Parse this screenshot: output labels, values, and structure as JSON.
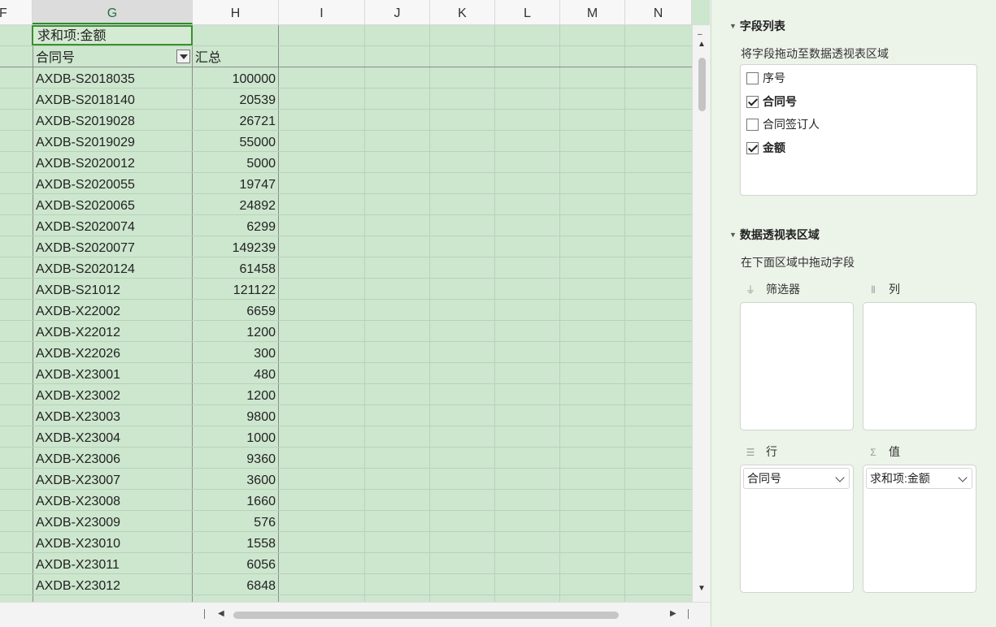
{
  "sheet": {
    "columns": [
      "F",
      "G",
      "H",
      "I",
      "J",
      "K",
      "L",
      "M",
      "N"
    ],
    "selected_column": "G",
    "pivot_title": "求和项:金额",
    "row_header_label": "合同号",
    "total_header_label": "汇总",
    "rows": [
      {
        "contract": "AXDB-S2018035",
        "amount": "100000"
      },
      {
        "contract": "AXDB-S2018140",
        "amount": "20539"
      },
      {
        "contract": "AXDB-S2019028",
        "amount": "26721"
      },
      {
        "contract": "AXDB-S2019029",
        "amount": "55000"
      },
      {
        "contract": "AXDB-S2020012",
        "amount": "5000"
      },
      {
        "contract": "AXDB-S2020055",
        "amount": "19747"
      },
      {
        "contract": "AXDB-S2020065",
        "amount": "24892"
      },
      {
        "contract": "AXDB-S2020074",
        "amount": "6299"
      },
      {
        "contract": "AXDB-S2020077",
        "amount": "149239"
      },
      {
        "contract": "AXDB-S2020124",
        "amount": "61458"
      },
      {
        "contract": "AXDB-S21012",
        "amount": "121122"
      },
      {
        "contract": "AXDB-X22002",
        "amount": "6659"
      },
      {
        "contract": "AXDB-X22012",
        "amount": "1200"
      },
      {
        "contract": "AXDB-X22026",
        "amount": "300"
      },
      {
        "contract": "AXDB-X23001",
        "amount": "480"
      },
      {
        "contract": "AXDB-X23002",
        "amount": "1200"
      },
      {
        "contract": "AXDB-X23003",
        "amount": "9800"
      },
      {
        "contract": "AXDB-X23004",
        "amount": "1000"
      },
      {
        "contract": "AXDB-X23006",
        "amount": "9360"
      },
      {
        "contract": "AXDB-X23007",
        "amount": "3600"
      },
      {
        "contract": "AXDB-X23008",
        "amount": "1660"
      },
      {
        "contract": "AXDB-X23009",
        "amount": "576"
      },
      {
        "contract": "AXDB-X23010",
        "amount": "1558"
      },
      {
        "contract": "AXDB-X23011",
        "amount": "6056"
      },
      {
        "contract": "AXDB-X23012",
        "amount": "6848"
      }
    ]
  },
  "pane": {
    "field_list_title": "字段列表",
    "field_list_hint": "将字段拖动至数据透视表区域",
    "fields": [
      {
        "label": "序号",
        "checked": false
      },
      {
        "label": "合同号",
        "checked": true
      },
      {
        "label": "合同签订人",
        "checked": false
      },
      {
        "label": "金额",
        "checked": true
      }
    ],
    "areas_title": "数据透视表区域",
    "areas_hint": "在下面区域中拖动字段",
    "filter_label": "筛选器",
    "columns_label": "列",
    "rows_label": "行",
    "values_label": "值",
    "rows_chip": "合同号",
    "values_chip": "求和项:金额"
  },
  "colors": {
    "sheet_fill": "#cde6ce",
    "selection_border": "#3a8f31",
    "pane_bg": "#ecf3e9"
  }
}
